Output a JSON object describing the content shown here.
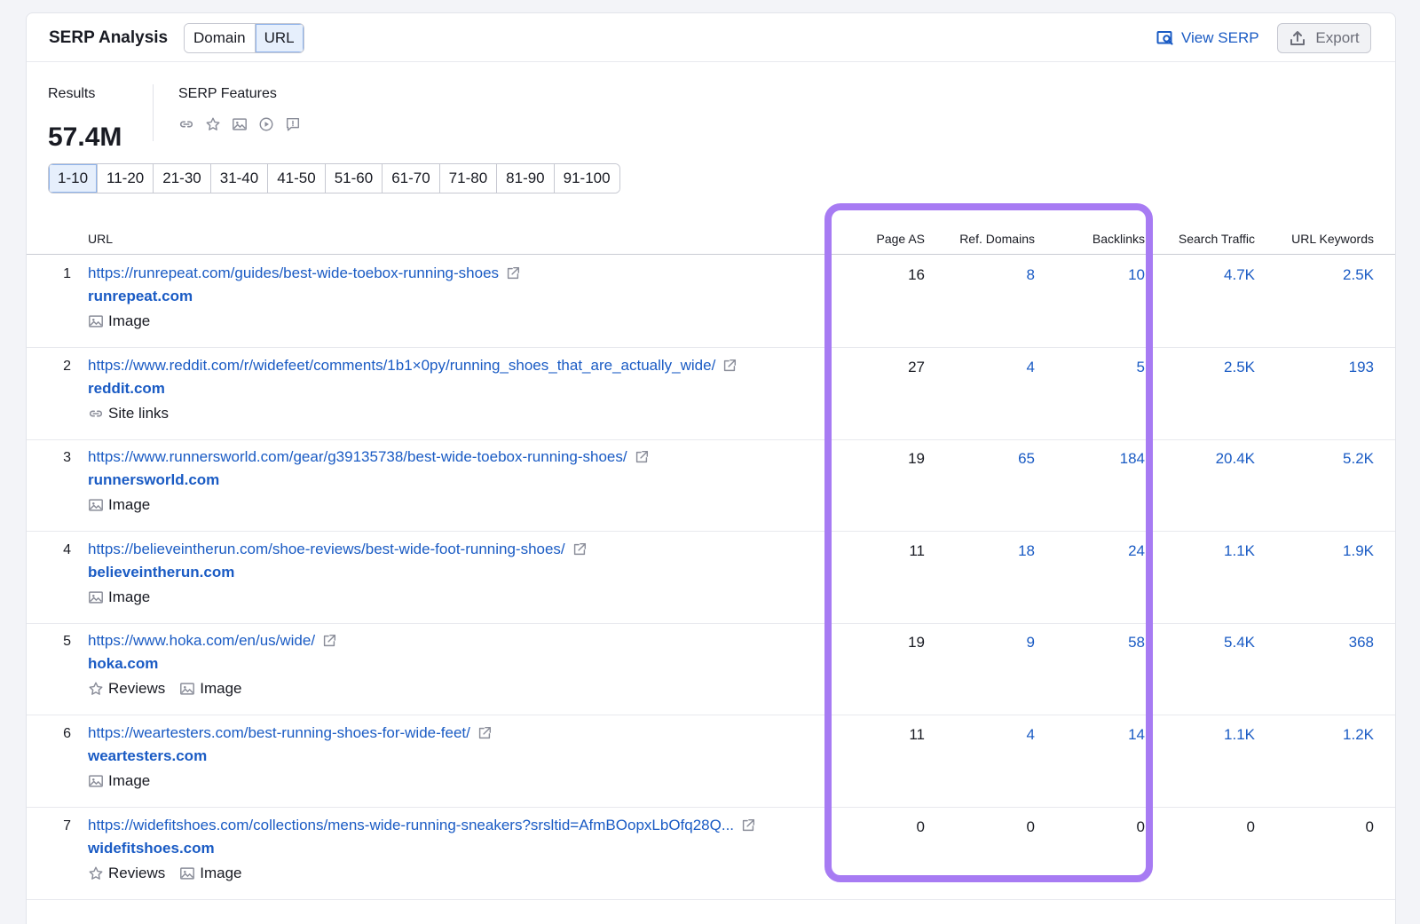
{
  "header": {
    "title": "SERP Analysis",
    "toggle": [
      "Domain",
      "URL"
    ],
    "toggle_active": "URL",
    "view_serp": "View SERP",
    "export": "Export"
  },
  "summary": {
    "results_label": "Results",
    "results_value": "57.4M",
    "features_label": "SERP Features",
    "feature_icons": [
      "link-icon",
      "star-icon",
      "image-icon",
      "video-icon",
      "faq-icon"
    ]
  },
  "pagination": [
    "1-10",
    "11-20",
    "21-30",
    "31-40",
    "41-50",
    "51-60",
    "61-70",
    "71-80",
    "81-90",
    "91-100"
  ],
  "pagination_active": "1-10",
  "table": {
    "columns": {
      "url": "URL",
      "page_as": "Page AS",
      "ref_domains": "Ref. Domains",
      "backlinks": "Backlinks",
      "search_traffic": "Search Traffic",
      "url_keywords": "URL Keywords"
    },
    "rows": [
      {
        "n": "1",
        "url": "https://runrepeat.com/guides/best-wide-toebox-running-shoes",
        "domain": "runrepeat.com",
        "features": [
          "Image"
        ],
        "page_as": "16",
        "ref_domains": "8",
        "backlinks": "10",
        "search_traffic": "4.7K",
        "url_keywords": "2.5K"
      },
      {
        "n": "2",
        "url": "https://www.reddit.com/r/widefeet/comments/1b1×0py/running_shoes_that_are_actually_wide/",
        "domain": "reddit.com",
        "features": [
          "Site links"
        ],
        "page_as": "27",
        "ref_domains": "4",
        "backlinks": "5",
        "search_traffic": "2.5K",
        "url_keywords": "193"
      },
      {
        "n": "3",
        "url": "https://www.runnersworld.com/gear/g39135738/best-wide-toebox-running-shoes/",
        "domain": "runnersworld.com",
        "features": [
          "Image"
        ],
        "page_as": "19",
        "ref_domains": "65",
        "backlinks": "184",
        "search_traffic": "20.4K",
        "url_keywords": "5.2K"
      },
      {
        "n": "4",
        "url": "https://believeintherun.com/shoe-reviews/best-wide-foot-running-shoes/",
        "domain": "believeintherun.com",
        "features": [
          "Image"
        ],
        "page_as": "11",
        "ref_domains": "18",
        "backlinks": "24",
        "search_traffic": "1.1K",
        "url_keywords": "1.9K"
      },
      {
        "n": "5",
        "url": "https://www.hoka.com/en/us/wide/",
        "domain": "hoka.com",
        "features": [
          "Reviews",
          "Image"
        ],
        "page_as": "19",
        "ref_domains": "9",
        "backlinks": "58",
        "search_traffic": "5.4K",
        "url_keywords": "368"
      },
      {
        "n": "6",
        "url": "https://weartesters.com/best-running-shoes-for-wide-feet/",
        "domain": "weartesters.com",
        "features": [
          "Image"
        ],
        "page_as": "11",
        "ref_domains": "4",
        "backlinks": "14",
        "search_traffic": "1.1K",
        "url_keywords": "1.2K"
      },
      {
        "n": "7",
        "url": "https://widefitshoes.com/collections/mens-wide-running-sneakers?srsltid=AfmBOopxLbOfq28Q...",
        "domain": "widefitshoes.com",
        "features": [
          "Reviews",
          "Image"
        ],
        "page_as": "0",
        "ref_domains": "0",
        "backlinks": "0",
        "search_traffic": "0",
        "url_keywords": "0"
      }
    ]
  },
  "colors": {
    "link": "#1a5bc4",
    "highlight": "#a77bf3",
    "active_bg": "#e6effc"
  }
}
